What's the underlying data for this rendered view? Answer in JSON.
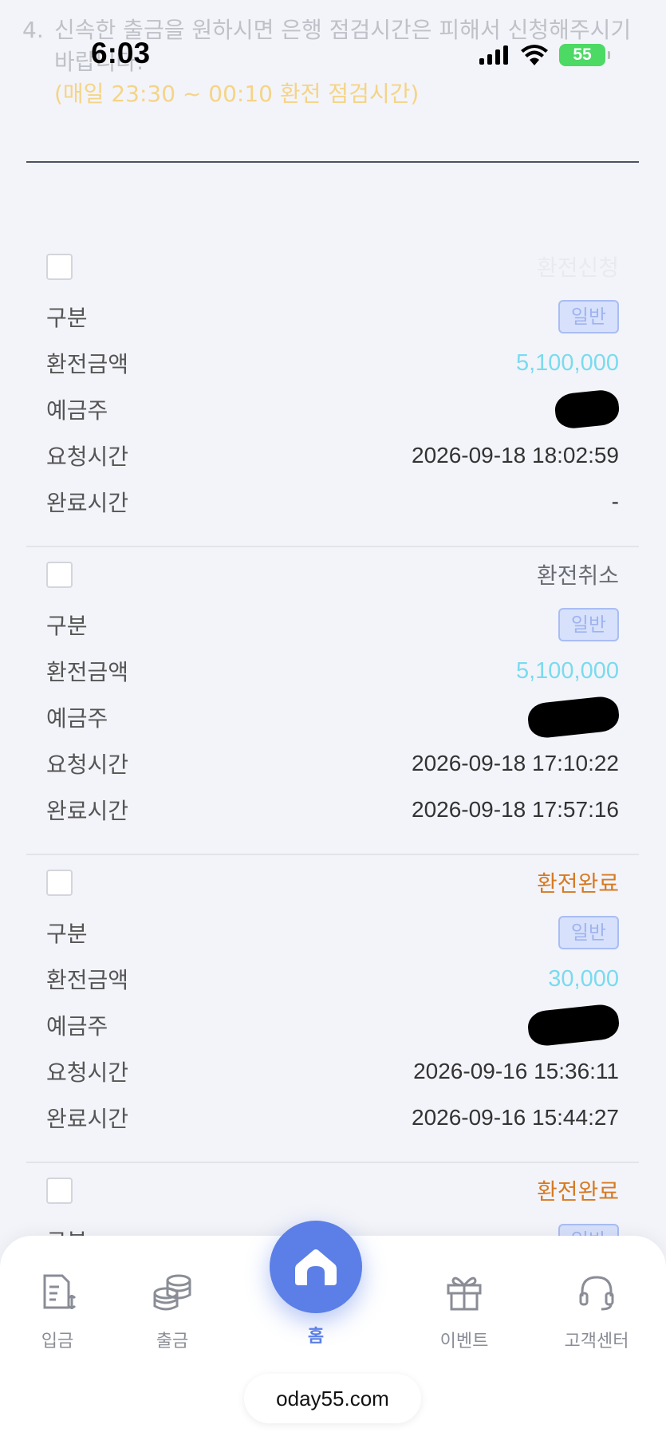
{
  "status_bar": {
    "time": "6:03",
    "battery": "55"
  },
  "notice": {
    "number": "4.",
    "text": "신속한 출금을 원하시면 은행 점검시간은 피해서 신청해주시기 바랍니다.",
    "maintenance": "(매일 23:30 ~ 00:10 환전 점검시간)"
  },
  "labels": {
    "type": "구분",
    "amount": "환전금액",
    "holder": "예금주",
    "requested": "요청시간",
    "completed": "완료시간"
  },
  "records": [
    {
      "status": "환전신청",
      "type": "일반",
      "amount": "5,100,000",
      "requested": "2026-09-18 18:02:59",
      "completed": "-"
    },
    {
      "status": "환전취소",
      "type": "일반",
      "amount": "5,100,000",
      "requested": "2026-09-18 17:10:22",
      "completed": "2026-09-18 17:57:16"
    },
    {
      "status": "환전완료",
      "type": "일반",
      "amount": "30,000",
      "requested": "2026-09-16 15:36:11",
      "completed": "2026-09-16 15:44:27"
    },
    {
      "status": "환전완료",
      "type": "일반"
    }
  ],
  "nav": {
    "deposit": "입금",
    "withdraw": "출금",
    "home": "홈",
    "event": "이벤트",
    "support": "고객센터"
  },
  "url": "oday55.com",
  "colors": {
    "accent": "#5b7fe6",
    "amount": "#79dbef",
    "complete": "#d67a24"
  }
}
